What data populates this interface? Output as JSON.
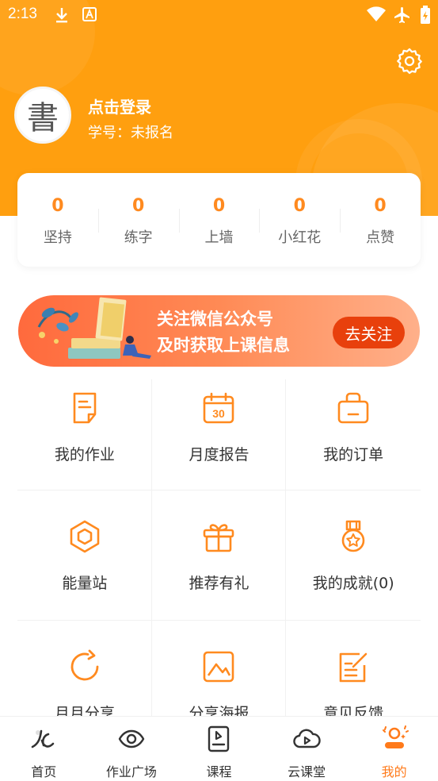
{
  "status_bar": {
    "time": "2:13"
  },
  "colors": {
    "accent": "#ff9f0f",
    "active_nav": "#ff7a1a",
    "stat_number": "#ff8a1f",
    "follow_button": "#e8400c"
  },
  "profile": {
    "avatar_char": "書",
    "login_label": "点击登录",
    "student_id": "学号：未报名"
  },
  "stats": [
    {
      "value": "0",
      "label": "坚持"
    },
    {
      "value": "0",
      "label": "练字"
    },
    {
      "value": "0",
      "label": "上墙"
    },
    {
      "value": "0",
      "label": "小红花"
    },
    {
      "value": "0",
      "label": "点赞"
    }
  ],
  "banner": {
    "line1": "关注微信公众号",
    "line2": "及时获取上课信息",
    "button": "去关注"
  },
  "grid": [
    {
      "label": "我的作业",
      "icon": "homework-icon"
    },
    {
      "label": "月度报告",
      "icon": "calendar-icon"
    },
    {
      "label": "我的订单",
      "icon": "shopping-bag-icon"
    },
    {
      "label": "能量站",
      "icon": "hexagon-icon"
    },
    {
      "label": "推荐有礼",
      "icon": "gift-icon"
    },
    {
      "label": "我的成就(0)",
      "icon": "medal-icon"
    },
    {
      "label": "月月分享",
      "icon": "share-refresh-icon"
    },
    {
      "label": "分享海报",
      "icon": "image-icon"
    },
    {
      "label": "意见反馈",
      "icon": "feedback-icon"
    }
  ],
  "nav": [
    {
      "label": "首页",
      "icon": "home-brush-icon"
    },
    {
      "label": "作业广场",
      "icon": "eye-icon"
    },
    {
      "label": "课程",
      "icon": "course-icon"
    },
    {
      "label": "云课堂",
      "icon": "cloud-play-icon"
    },
    {
      "label": "我的",
      "icon": "profile-icon",
      "active": true
    }
  ]
}
